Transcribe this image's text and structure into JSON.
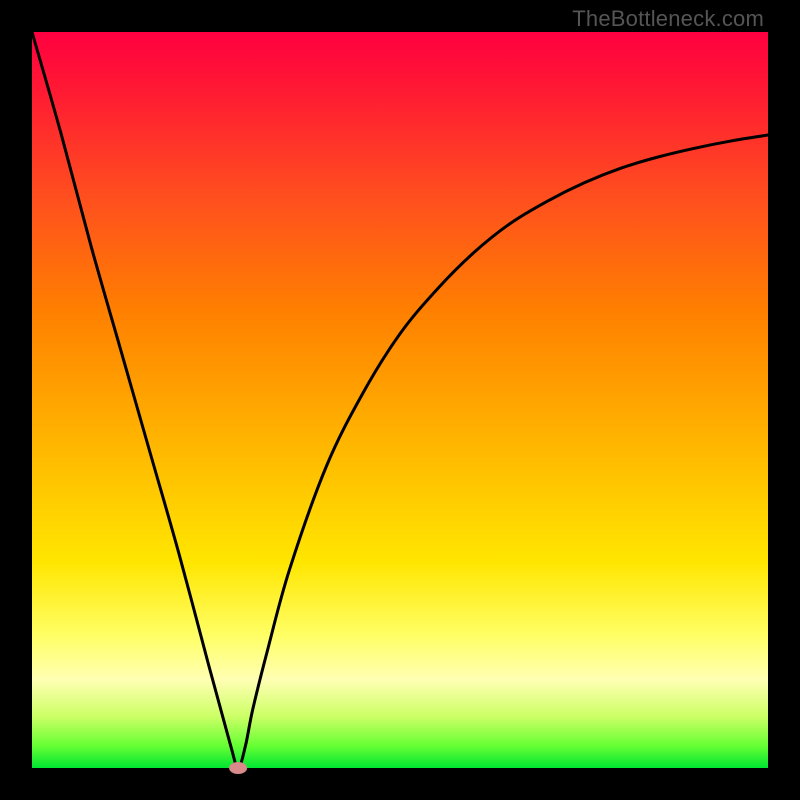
{
  "watermark": "TheBottleneck.com",
  "chart_data": {
    "type": "line",
    "title": "",
    "xlabel": "",
    "ylabel": "",
    "xlim": [
      0,
      100
    ],
    "ylim": [
      0,
      100
    ],
    "grid": false,
    "legend": false,
    "series": [
      {
        "name": "curve",
        "x": [
          0,
          4,
          8,
          12,
          16,
          20,
          24,
          27,
          28,
          29,
          30,
          32,
          35,
          40,
          45,
          50,
          55,
          60,
          65,
          70,
          75,
          80,
          85,
          90,
          95,
          100
        ],
        "y": [
          100,
          86,
          71,
          57,
          43,
          29,
          14,
          3,
          0,
          3,
          8,
          16,
          27,
          41,
          51,
          59,
          65,
          70,
          74,
          77,
          79.5,
          81.5,
          83,
          84.2,
          85.2,
          86
        ]
      }
    ],
    "marker": {
      "x": 28,
      "y": 0,
      "color": "#d98a8a"
    },
    "colors": {
      "curve": "#000000",
      "background_top": "#ff0040",
      "background_bottom": "#00e633",
      "frame": "#000000"
    }
  }
}
